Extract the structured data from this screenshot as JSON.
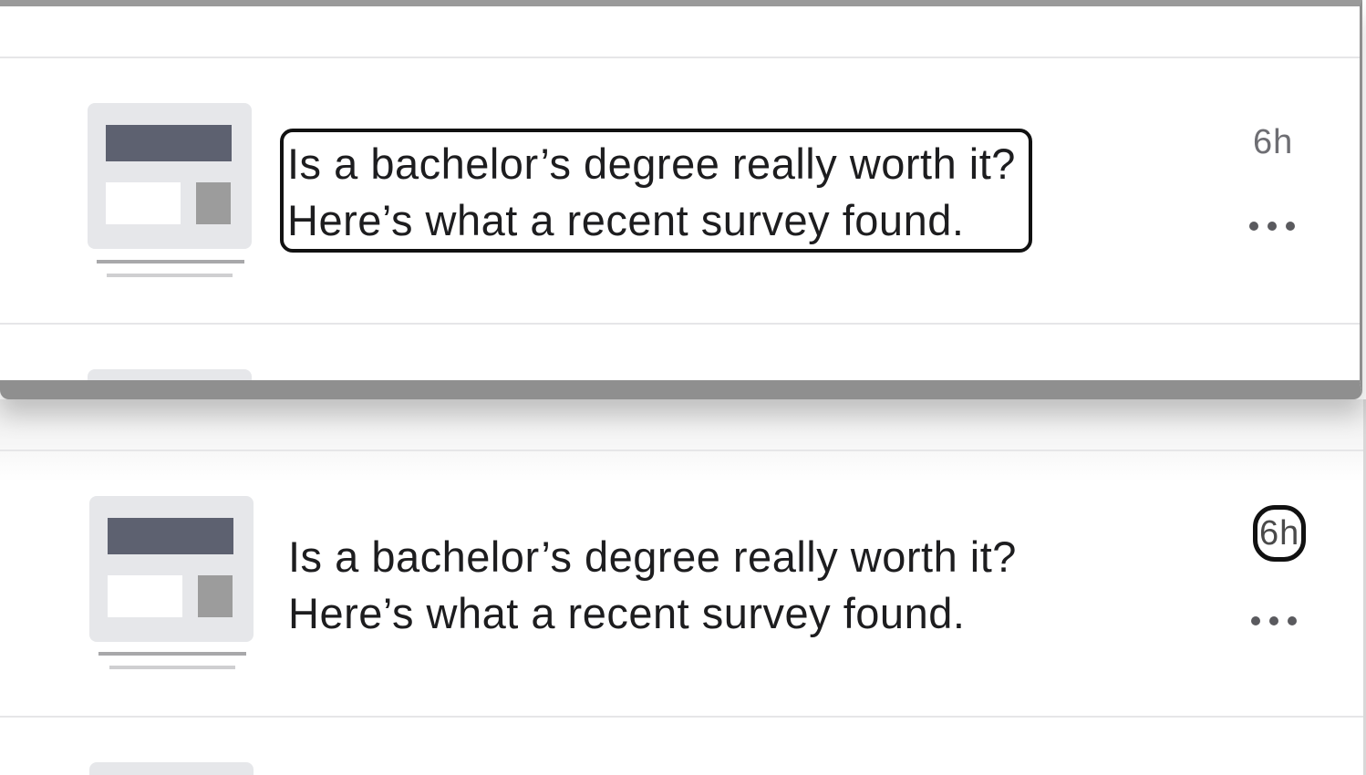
{
  "feed": {
    "floating_row": {
      "headline_line1": "Is a bachelor’s degree really worth it?",
      "headline_line2": "Here’s what a recent survey found.",
      "time": "6h",
      "more_icon": "more-horizontal-icon",
      "thumbnail_icon": "article-placeholder-icon"
    },
    "list_row": {
      "headline_line1": "Is a bachelor’s degree really worth it?",
      "headline_line2": "Here’s what a recent survey found.",
      "time": "6h",
      "more_icon": "more-horizontal-icon",
      "thumbnail_icon": "article-placeholder-icon"
    }
  },
  "colors": {
    "text": "#1d1d1f",
    "secondary_text": "#6e6e73",
    "thumbnail_bg": "#e6e7ea",
    "thumbnail_dark_bar": "#5d6170",
    "focus_outline": "#111111",
    "panel_border": "#8f8f8f"
  }
}
